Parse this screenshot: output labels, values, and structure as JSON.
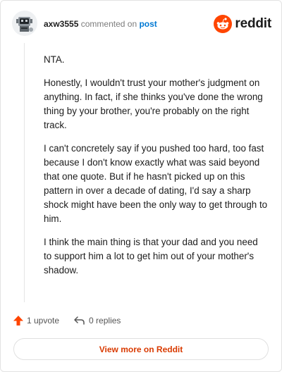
{
  "comment": {
    "username": "axw3555",
    "action_text": "commented on",
    "post_link": "post",
    "paragraphs": [
      "NTA.",
      "Honestly, I wouldn't trust your mother's judgment on anything. In fact, if she thinks you've done the wrong thing by your brother, you're probably on the right track.",
      "I can't concretely say if you pushed too hard, too fast because I don't know exactly what was said beyond that one quote. But if he hasn't picked up on this pattern in over a decade of dating, I'd say a sharp shock might have been the only way to get through to him.",
      "I think the main thing is that your dad and you need to support him a lot to get him out of your mother's shadow."
    ],
    "upvotes": "1 upvote",
    "replies": "0 replies"
  },
  "brand": {
    "name": "reddit",
    "icon": "reddit-logo-icon",
    "color": "#ff4500"
  },
  "footer": {
    "view_more_label": "View more on Reddit",
    "accent": "#d93a00"
  },
  "icons": {
    "avatar": "robot-avatar",
    "upvote": "upvote-arrow-icon",
    "reply": "reply-arrow-icon"
  }
}
